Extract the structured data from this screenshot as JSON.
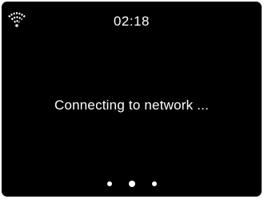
{
  "status_bar": {
    "time": "02:18",
    "wifi_icon": "wifi-icon"
  },
  "main": {
    "message": "Connecting to network ..."
  },
  "progress_indicator": {
    "dot_count": 3,
    "active_dot": 2
  },
  "colors": {
    "background": "#000000",
    "foreground": "#ffffff"
  }
}
